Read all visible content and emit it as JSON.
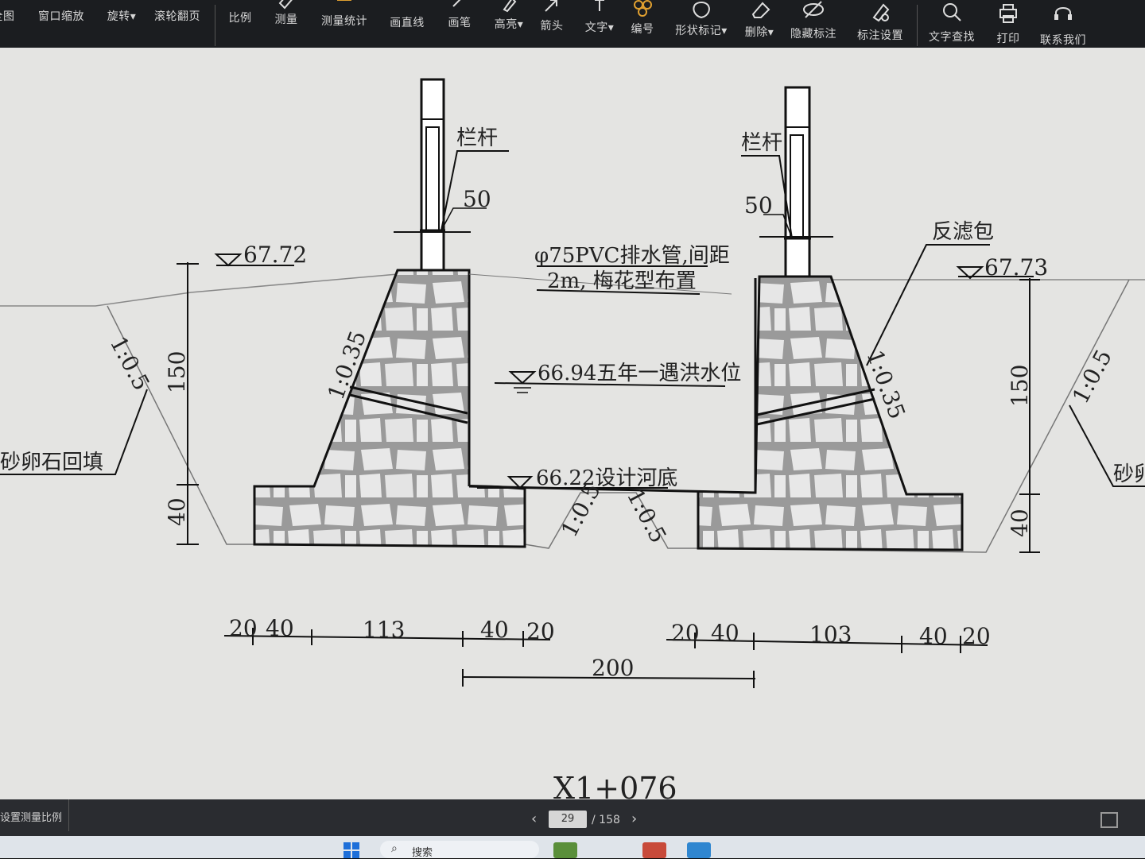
{
  "toolbar": {
    "items": [
      {
        "label": "全图",
        "icon": "fit-page-icon"
      },
      {
        "label": "窗口缩放",
        "icon": "window-zoom-icon"
      },
      {
        "label": "旋转▾",
        "icon": "rotate-icon"
      },
      {
        "label": "滚轮翻页",
        "icon": "scroll-page-icon"
      },
      {
        "label": "比例",
        "icon": "scale-icon"
      },
      {
        "label": "测量",
        "icon": "measure-icon"
      },
      {
        "label": "测量统计",
        "icon": "measure-stats-icon"
      },
      {
        "label": "画直线",
        "icon": "line-icon"
      },
      {
        "label": "画笔",
        "icon": "pen-icon"
      },
      {
        "label": "高亮▾",
        "icon": "highlight-icon"
      },
      {
        "label": "箭头",
        "icon": "arrow-icon"
      },
      {
        "label": "文字▾",
        "icon": "text-icon"
      },
      {
        "label": "编号",
        "icon": "number-icon"
      },
      {
        "label": "形状标记▾",
        "icon": "shape-mark-icon"
      },
      {
        "label": "删除▾",
        "icon": "eraser-icon"
      },
      {
        "label": "隐藏标注",
        "icon": "eye-hide-icon"
      },
      {
        "label": "标注设置",
        "icon": "annotation-settings-icon"
      },
      {
        "label": "文字查找",
        "icon": "search-icon"
      },
      {
        "label": "打印",
        "icon": "printer-icon"
      },
      {
        "label": "联系我们",
        "icon": "headset-icon"
      }
    ]
  },
  "drawing": {
    "railing_left": "栏杆",
    "railing_right": "栏杆",
    "dim_50_left": "50",
    "dim_50_right": "50",
    "elev_left": "67.72",
    "elev_right": "67.73",
    "pipe_note_line1": "φ75PVC排水管,间距",
    "pipe_note_line2": "2m, 梅花型布置",
    "filter_pack": "反滤包",
    "flood_level": "66.94五年一遇洪水位",
    "riverbed": "66.22设计河底",
    "backfill_left": "砂卵石回填",
    "backfill_right": "砂卵",
    "slope_035_left": "1:0.35",
    "slope_035_right": "1:0.35",
    "slope_05_left": "1:0.5",
    "slope_05_right": "1:0.5",
    "slope_05_bot_left": "1:0.5",
    "slope_05_bot_right": "1:0.5",
    "dim_150_left": "150",
    "dim_40_left": "40",
    "dim_150_right": "150",
    "dim_40_right": "40",
    "bottom_dims_left": [
      "20",
      "40",
      "113",
      "40",
      "20"
    ],
    "bottom_dims_right": [
      "20",
      "40",
      "103",
      "40",
      "20"
    ],
    "dim_200": "200",
    "section_label": "X1+076"
  },
  "statusbar": {
    "left_label": "设置测量比例",
    "current_page": "29",
    "total_pages": "/ 158"
  },
  "taskbar": {
    "search_text": "搜索"
  }
}
